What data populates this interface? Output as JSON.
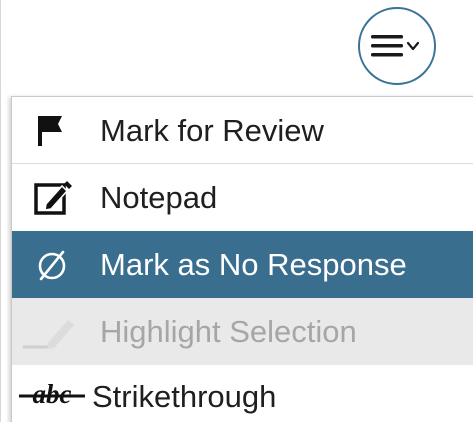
{
  "menu_button": {
    "icon": "hamburger-menu-icon",
    "chevron_icon": "chevron-down-icon",
    "accent_color": "#3a7397"
  },
  "tool_menu": {
    "items": [
      {
        "label": "Mark for Review",
        "icon": "flag-icon",
        "state": "normal"
      },
      {
        "label": "Notepad",
        "icon": "notepad-edit-icon",
        "state": "normal"
      },
      {
        "label": "Mark as No Response",
        "icon": "no-response-icon",
        "state": "highlighted"
      },
      {
        "label": "Highlight Selection",
        "icon": "highlighter-icon",
        "state": "disabled"
      },
      {
        "label": "Strikethrough",
        "icon": "strikethrough-abc-icon",
        "icon_text": "abc",
        "state": "normal"
      }
    ]
  },
  "colors": {
    "highlight_bg": "#3a6e8f",
    "disabled_bg": "#e9e9e9",
    "disabled_text": "#a6a6a6"
  }
}
